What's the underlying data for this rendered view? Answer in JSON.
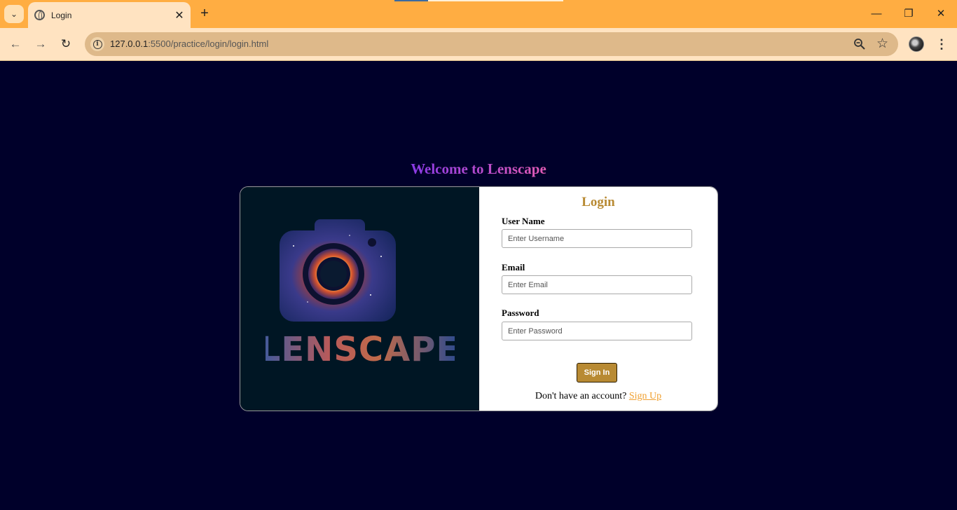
{
  "browser": {
    "tab_title": "Login",
    "url_host": "127.0.0.1",
    "url_rest": ":5500/practice/login/login.html"
  },
  "icons": {
    "tab_search": "chevron-down-icon",
    "favicon": "globe-icon",
    "tab_close": "close-icon",
    "new_tab": "plus-icon",
    "back": "arrow-left-icon",
    "forward": "arrow-right-icon",
    "reload": "reload-icon",
    "site_info": "info-icon",
    "zoom": "zoom-out-icon",
    "bookmark": "star-icon",
    "menu": "more-vert-icon"
  },
  "glyphs": {
    "tab_search": "⌄",
    "tab_close": "✕",
    "new_tab": "+",
    "back": "←",
    "forward": "→",
    "reload": "↻",
    "info": "i",
    "star": "☆",
    "menu": "⋮",
    "minimize": "—",
    "restore": "❐",
    "close": "✕"
  },
  "page": {
    "welcome": "Welcome to Lenscape",
    "logo_text": "LENSCAPE",
    "login_title": "Login",
    "username_label": "User Name",
    "username_placeholder": "Enter Username",
    "email_label": "Email",
    "email_placeholder": "Enter Email",
    "password_label": "Password",
    "password_placeholder": "Enter Password",
    "signin_label": "Sign In",
    "no_account_text": "Don't have an account?",
    "signup_link": "Sign Up"
  },
  "colors": {
    "page_bg": "#00002a",
    "tabbar": "#ffad42",
    "accent_gold": "#b88a33",
    "link": "#f0a030",
    "logo_panel": "#001624"
  }
}
